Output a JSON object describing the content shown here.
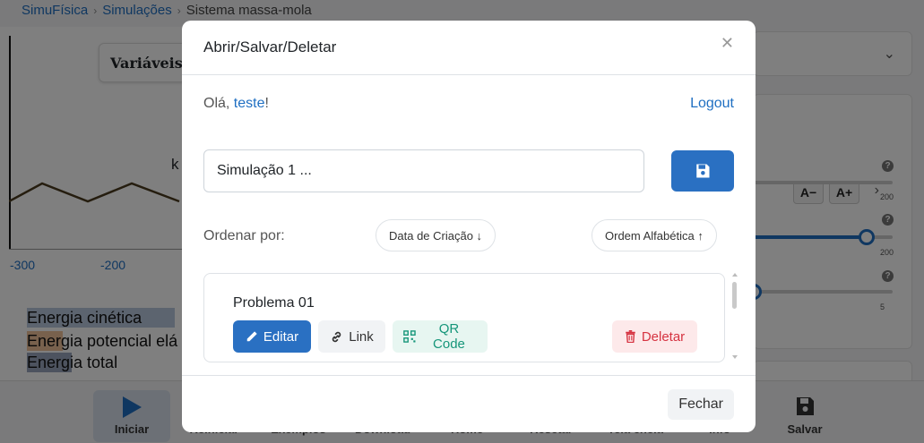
{
  "breadcrumb": {
    "home": "SimuFísica",
    "section": "Simulações",
    "current": "Sistema massa-mola"
  },
  "background": {
    "vars_title": "Variáveis",
    "spring_label": "k",
    "axis_ticks": [
      "-300",
      "-200"
    ],
    "energy_legend": [
      {
        "label": "Energia cinética",
        "color": "#b9c9df"
      },
      {
        "label": "Energia potencial elá",
        "color": "#f1c29a"
      },
      {
        "label": "Energia total",
        "color": "#9aa6bf"
      }
    ],
    "font_decrease": "A−",
    "font_increase": "A+",
    "slider_values": [
      "200",
      "200",
      "5"
    ],
    "bottom_nav": [
      {
        "label": "Iniciar",
        "active": true
      },
      {
        "label": "Reiniciar"
      },
      {
        "label": "Exemplos"
      },
      {
        "label": "Download"
      },
      {
        "label": "Home"
      },
      {
        "label": "Resetar"
      },
      {
        "label": "Tela cheia"
      },
      {
        "label": "Info"
      },
      {
        "label": "Salvar"
      }
    ]
  },
  "modal": {
    "title": "Abrir/Salvar/Deletar",
    "greeting_prefix": "Olá, ",
    "username": "teste",
    "greeting_suffix": "!",
    "logout": "Logout",
    "name_value": "Simulação 1 ...",
    "sort_label": "Ordenar por:",
    "sort_date": "Data de Criação ↓",
    "sort_alpha": "Ordem Alfabética ↑",
    "items": [
      {
        "title": "Problema 01",
        "edit": "Editar",
        "link": "Link",
        "qr": "QR Code",
        "delete": "Deletar"
      }
    ],
    "close": "Fechar"
  },
  "colors": {
    "primary": "#2a70c2",
    "danger": "#d63341",
    "success": "#16967a"
  }
}
